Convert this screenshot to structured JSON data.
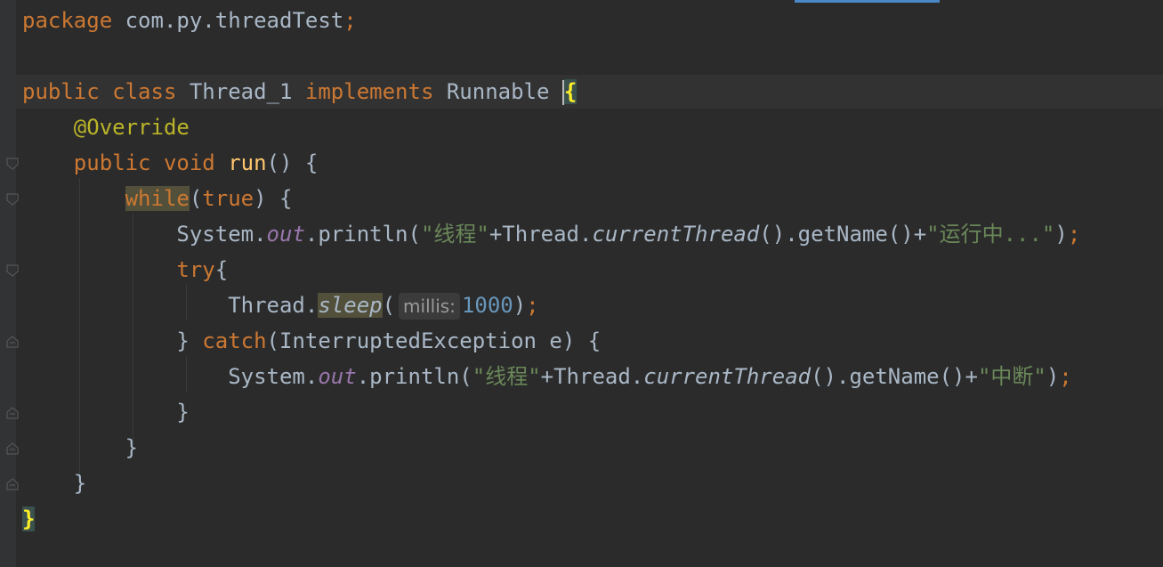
{
  "editor": {
    "language": "java",
    "theme_colors": {
      "background": "#2b2b2b",
      "keyword": "#cc7832",
      "annotation": "#bbb529",
      "method_decl": "#ffc66d",
      "string": "#6a8759",
      "static_field": "#9876aa",
      "number": "#6897bb",
      "default_text": "#a9b7c6"
    },
    "lines": {
      "l1": {
        "kw_package": "package",
        "pkg_name": " com.py.threadTest",
        "semi": ";"
      },
      "l3": {
        "kw_public": "public",
        "kw_class": "class",
        "class_name": " Thread_1 ",
        "kw_implements": "implements",
        "iface": " Runnable ",
        "brace": "{"
      },
      "l4": {
        "annotation": "@Override"
      },
      "l5": {
        "kw_public": "public",
        "kw_void": "void",
        "method": "run",
        "rest": "() {"
      },
      "l6": {
        "kw_while": "while",
        "open": "(",
        "kw_true": "true",
        "rest": ") {"
      },
      "l7": {
        "sys": "System.",
        "out": "out",
        "println": ".println(",
        "str1": "\"线程\"",
        "plus1": "+Thread.",
        "current": "currentThread",
        "getname": "().getName()+",
        "str2": "\"运行中...\"",
        "close": ")",
        "semi": ";"
      },
      "l8": {
        "kw_try": "try",
        "brace": "{"
      },
      "l9": {
        "thread": "Thread.",
        "sleep": "sleep",
        "open": "(",
        "hint": "millis:",
        "num": "1000",
        "close": ")",
        "semi": ";"
      },
      "l10": {
        "close_brace": "} ",
        "kw_catch": "catch",
        "rest": "(InterruptedException e) {"
      },
      "l11": {
        "sys": "System.",
        "out": "out",
        "println": ".println(",
        "str1": "\"线程\"",
        "plus1": "+Thread.",
        "current": "currentThread",
        "getname": "().getName()+",
        "str2": "\"中断\"",
        "close": ")",
        "semi": ";"
      },
      "l12": {
        "brace": "}"
      },
      "l13": {
        "brace": "}"
      },
      "l14": {
        "brace": "}"
      },
      "l15": {
        "brace": "}"
      }
    }
  }
}
